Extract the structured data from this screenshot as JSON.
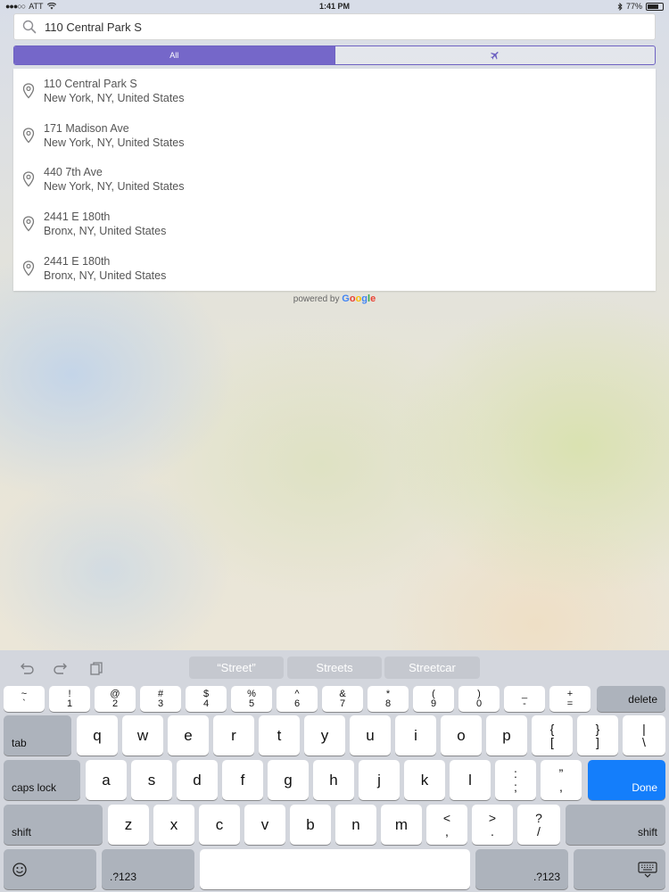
{
  "status_bar": {
    "carrier": "ATT",
    "time": "1:41 PM",
    "battery": "77%",
    "battery_level": 0.77
  },
  "search": {
    "value": "110 Central Park S",
    "placeholder": ""
  },
  "segments": [
    {
      "label": "All",
      "active": true
    },
    {
      "icon": "airplane-icon",
      "active": false
    }
  ],
  "results": [
    {
      "line1": "110 Central Park S",
      "line2": "New York, NY, United States"
    },
    {
      "line1": "171 Madison Ave",
      "line2": "New York, NY, United States"
    },
    {
      "line1": "440 7th Ave",
      "line2": "New York, NY, United States"
    },
    {
      "line1": "2441 E 180th",
      "line2": "Bronx, NY, United States"
    },
    {
      "line1": "2441 E 180th",
      "line2": "Bronx, NY, United States"
    }
  ],
  "attribution": {
    "prefix": "powered by",
    "brand_letters": [
      "G",
      "o",
      "o",
      "g",
      "l",
      "e"
    ]
  },
  "keyboard": {
    "suggestions": [
      "“Street”",
      "Streets",
      "Streetcar"
    ],
    "row1": [
      [
        "~",
        "`"
      ],
      [
        "!",
        "1"
      ],
      [
        "@",
        "2"
      ],
      [
        "#",
        "3"
      ],
      [
        "$",
        "4"
      ],
      [
        "%",
        "5"
      ],
      [
        "^",
        "6"
      ],
      [
        "&",
        "7"
      ],
      [
        "*",
        "8"
      ],
      [
        "(",
        "9"
      ],
      [
        ")",
        "0"
      ],
      [
        "_",
        "-"
      ],
      [
        "+",
        "="
      ]
    ],
    "delete": "delete",
    "tab": "tab",
    "row2": [
      "q",
      "w",
      "e",
      "r",
      "t",
      "y",
      "u",
      "i",
      "o",
      "p"
    ],
    "row2_punct": [
      [
        "{",
        "["
      ],
      [
        "}",
        "]"
      ],
      [
        "|",
        "\\"
      ]
    ],
    "caps": "caps lock",
    "row3": [
      "a",
      "s",
      "d",
      "f",
      "g",
      "h",
      "j",
      "k",
      "l"
    ],
    "row3_punct": [
      [
        ":",
        ";"
      ],
      [
        "”",
        ","
      ]
    ],
    "done": "Done",
    "shift": "shift",
    "row4": [
      "z",
      "x",
      "c",
      "v",
      "b",
      "n",
      "m"
    ],
    "row4_punct": [
      [
        "<",
        ","
      ],
      [
        ">",
        "."
      ],
      [
        "?",
        "/"
      ]
    ],
    "num": ".?123",
    "colors": {
      "accent": "#7567c9",
      "done": "#147efb"
    }
  }
}
